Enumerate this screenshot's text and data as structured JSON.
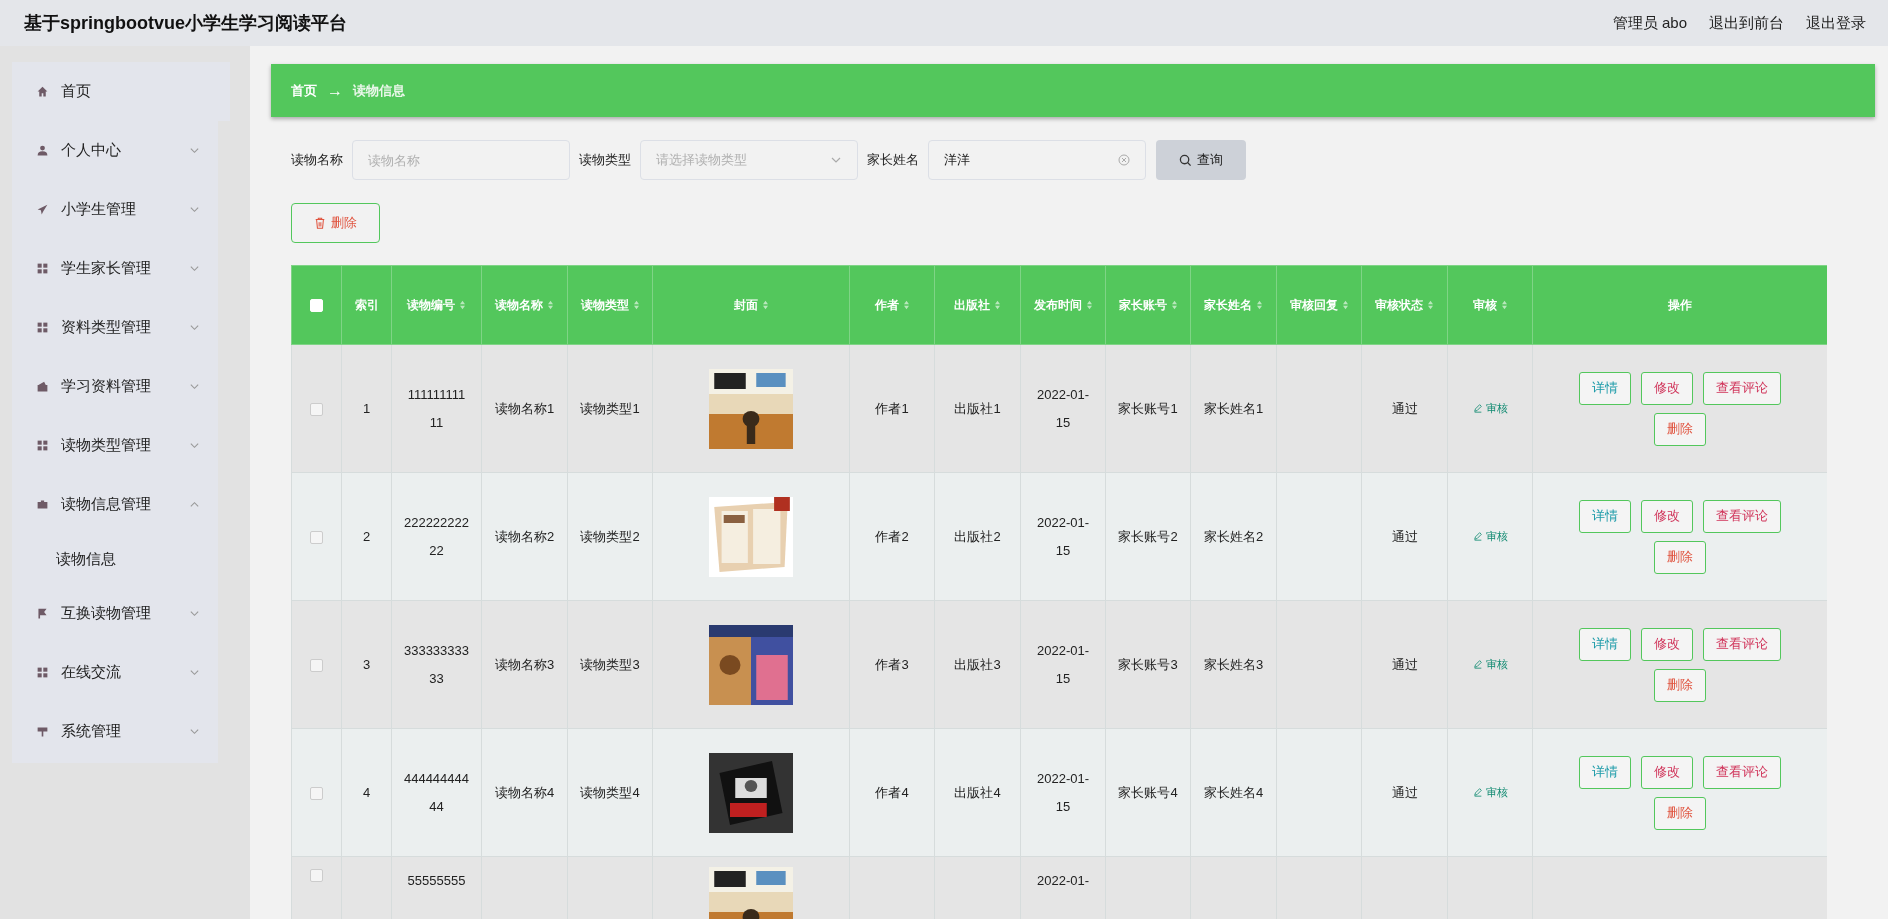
{
  "header": {
    "title": "基于springbootvue小学生学习阅读平台",
    "links": [
      "管理员 abo",
      "退出到前台",
      "退出登录"
    ]
  },
  "sidebar": {
    "items": [
      {
        "kind": "link",
        "label": "首页"
      },
      {
        "kind": "menu",
        "label": "个人中心"
      },
      {
        "kind": "menu",
        "label": "小学生管理"
      },
      {
        "kind": "menu",
        "label": "学生家长管理"
      },
      {
        "kind": "menu",
        "label": "资料类型管理"
      },
      {
        "kind": "menu",
        "label": "学习资料管理"
      },
      {
        "kind": "menu",
        "label": "读物类型管理"
      },
      {
        "kind": "menu",
        "label": "读物信息管理",
        "expanded": true,
        "children": [
          {
            "label": "读物信息"
          }
        ]
      },
      {
        "kind": "menu",
        "label": "互换读物管理"
      },
      {
        "kind": "menu",
        "label": "在线交流"
      },
      {
        "kind": "menu",
        "label": "系统管理"
      }
    ]
  },
  "breadcrumb": [
    "首页",
    "→",
    "读物信息"
  ],
  "search": {
    "fields": [
      {
        "kind": "input",
        "label": "读物名称",
        "placeholder": "读物名称"
      },
      {
        "kind": "select",
        "label": "读物类型",
        "placeholder": "请选择读物类型"
      },
      {
        "kind": "clearable",
        "label": "家长姓名",
        "value": "洋洋"
      }
    ],
    "button": "查询"
  },
  "delete_button": "删除",
  "table": {
    "select_all": {
      "checked": false
    },
    "columns": [
      {
        "label": "索引",
        "sortable": false
      },
      {
        "label": "读物编号",
        "sortable": true
      },
      {
        "label": "读物名称",
        "sortable": true
      },
      {
        "label": "读物类型",
        "sortable": true
      },
      {
        "label": "封面",
        "sortable": true
      },
      {
        "label": "作者",
        "sortable": true
      },
      {
        "label": "出版社",
        "sortable": true
      },
      {
        "label": "发布时间",
        "sortable": true
      },
      {
        "label": "家长账号",
        "sortable": true
      },
      {
        "label": "家长姓名",
        "sortable": true
      },
      {
        "label": "审核回复",
        "sortable": true
      },
      {
        "label": "审核状态",
        "sortable": true
      },
      {
        "label": "审核",
        "sortable": true
      },
      {
        "label": "操作",
        "sortable": false
      }
    ],
    "rows": [
      {
        "checked": false,
        "cells": [
          "1",
          "111111111 11",
          "读物名称1",
          "读物类型1",
          {
            "kind": "picture"
          },
          "作者1",
          "出版社1",
          "2022-01- 15",
          "家长账号1",
          "家长姓名1",
          "",
          "通过",
          "审核"
        ],
        "actions": [
          "详情",
          "修改",
          "查看评论",
          "删除"
        ]
      },
      {
        "checked": false,
        "cells": [
          "2",
          "222222222 22",
          "读物名称2",
          "读物类型2",
          {
            "kind": "picture"
          },
          "作者2",
          "出版社2",
          "2022-01- 15",
          "家长账号2",
          "家长姓名2",
          "",
          "通过",
          "审核"
        ],
        "actions": [
          "详情",
          "修改",
          "查看评论",
          "删除"
        ]
      },
      {
        "checked": false,
        "cells": [
          "3",
          "333333333 33",
          "读物名称3",
          "读物类型3",
          {
            "kind": "picture"
          },
          "作者3",
          "出版社3",
          "2022-01- 15",
          "家长账号3",
          "家长姓名3",
          "",
          "通过",
          "审核"
        ],
        "actions": [
          "详情",
          "修改",
          "查看评论",
          "删除"
        ]
      },
      {
        "checked": false,
        "cells": [
          "4",
          "444444444 44",
          "读物名称4",
          "读物类型4",
          {
            "kind": "picture"
          },
          "作者4",
          "出版社4",
          "2022-01- 15",
          "家长账号4",
          "家长姓名4",
          "",
          "通过",
          "审核"
        ],
        "actions": [
          "详情",
          "修改",
          "查看评论",
          "删除"
        ]
      },
      {
        "checked": false,
        "cells": [
          "",
          "55555555",
          "",
          "",
          {
            "kind": "picture"
          },
          "",
          "",
          "2022-01-",
          "",
          "",
          "",
          "",
          ""
        ]
      }
    ]
  }
}
